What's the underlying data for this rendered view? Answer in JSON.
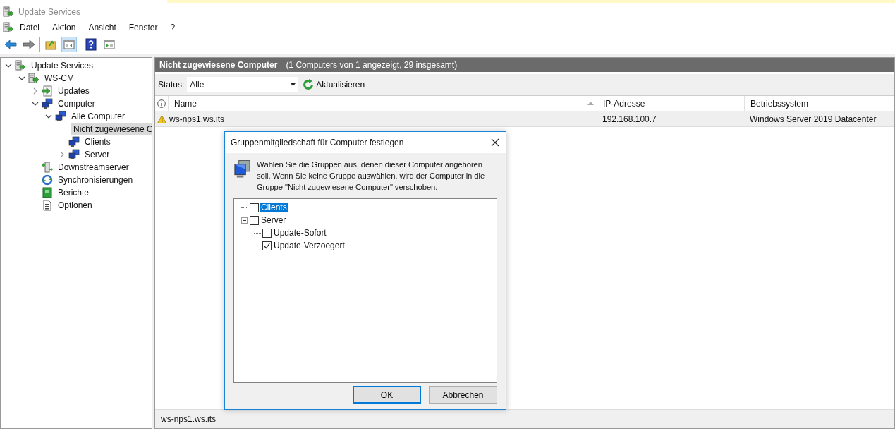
{
  "window": {
    "title": "Update Services"
  },
  "menu": [
    "Datei",
    "Aktion",
    "Ansicht",
    "Fenster",
    "?"
  ],
  "toolbar": [
    {
      "kind": "back",
      "selected": false
    },
    {
      "kind": "forward",
      "selected": false
    },
    {
      "kind": "up",
      "selected": false
    },
    {
      "kind": "tree-toggle",
      "selected": true
    },
    {
      "kind": "help",
      "selected": false
    },
    {
      "kind": "action-pane",
      "selected": false
    }
  ],
  "tree": [
    {
      "label": "Update Services",
      "kind": "server",
      "expanded": true,
      "selected": false,
      "children": [
        {
          "label": "WS-CM",
          "kind": "server",
          "expanded": true,
          "selected": false,
          "children": [
            {
              "label": "Updates",
              "kind": "updates",
              "expanded": false,
              "selected": false
            },
            {
              "label": "Computer",
              "kind": "computers",
              "expanded": true,
              "selected": false,
              "children": [
                {
                  "label": "Alle Computer",
                  "kind": "computers",
                  "expanded": true,
                  "selected": false,
                  "children": [
                    {
                      "label": "Nicht zugewiesene C",
                      "kind": "computers",
                      "selected": true
                    },
                    {
                      "label": "Clients",
                      "kind": "computers",
                      "selected": false
                    },
                    {
                      "label": "Server",
                      "kind": "computers",
                      "expanded": false,
                      "selected": false
                    }
                  ]
                }
              ]
            },
            {
              "label": "Downstreamserver",
              "kind": "downstream",
              "selected": false
            },
            {
              "label": "Synchronisierungen",
              "kind": "sync",
              "selected": false
            },
            {
              "label": "Berichte",
              "kind": "reports",
              "selected": false
            },
            {
              "label": "Optionen",
              "kind": "options",
              "selected": false
            }
          ]
        }
      ]
    }
  ],
  "pane": {
    "title": "Nicht zugewiesene Computer",
    "subtitle": "(1 Computers von 1 angezeigt, 29 insgesamt)",
    "status_label": "Status:",
    "status_value": "Alle",
    "refresh": "Aktualisieren",
    "columns": [
      {
        "label": "Name",
        "sorted": true
      },
      {
        "label": "IP-Adresse",
        "sorted": false
      },
      {
        "label": "Betriebssystem",
        "sorted": false
      }
    ],
    "rows": [
      {
        "warning": true,
        "selected": true,
        "cells": [
          "ws-nps1.ws.its",
          "192.168.100.7",
          "Windows Server 2019 Datacenter"
        ]
      }
    ],
    "status_bar": "ws-nps1.ws.its"
  },
  "dialog": {
    "title": "Gruppenmitgliedschaft für Computer festlegen",
    "message": "Wählen Sie die Gruppen aus, denen dieser Computer angehören soll. Wenn Sie keine Gruppe auswählen, wird der Computer in die Gruppe \"Nicht zugewiesene Computer\" verschoben.",
    "groups": [
      {
        "label": "Clients",
        "checked": false,
        "selected": true
      },
      {
        "label": "Server",
        "checked": false,
        "selected": false,
        "expanded": true,
        "children": [
          {
            "label": "Update-Sofort",
            "checked": false,
            "selected": false
          },
          {
            "label": "Update-Verzoegert",
            "checked": true,
            "selected": false
          }
        ]
      }
    ],
    "buttons": [
      {
        "label": "OK",
        "default": true
      },
      {
        "label": "Abbrechen",
        "default": false
      }
    ]
  }
}
